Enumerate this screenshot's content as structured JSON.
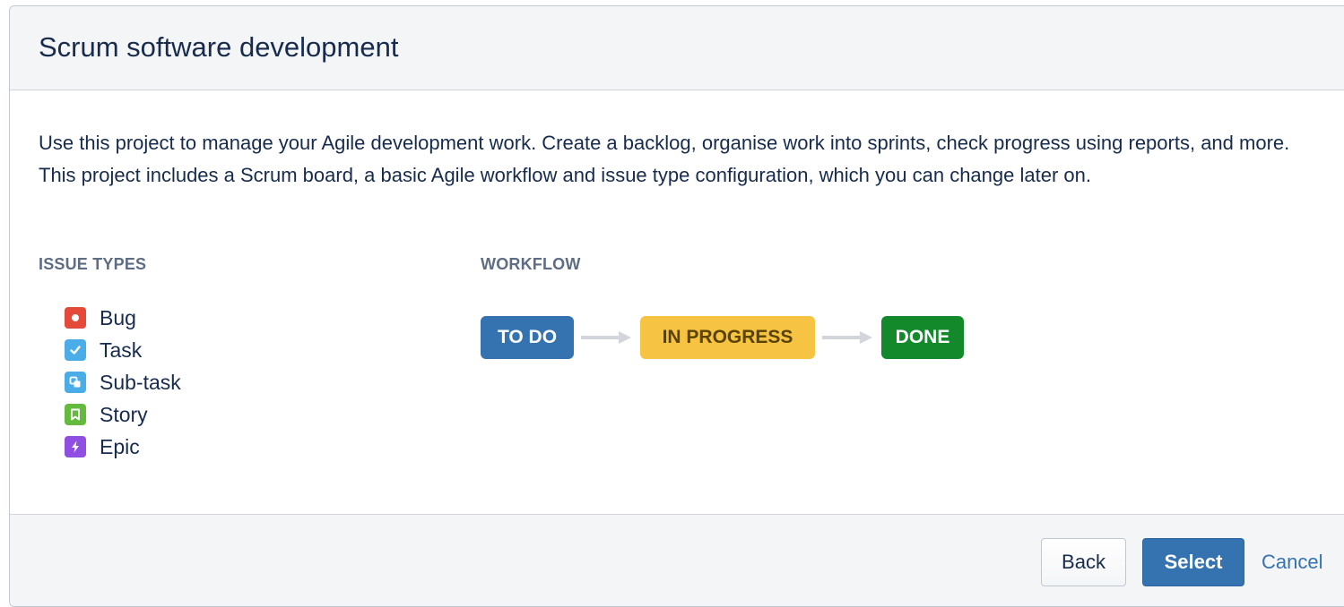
{
  "dialog": {
    "title": "Scrum software development",
    "description": "Use this project to manage your Agile development work. Create a backlog, organise work into sprints, check progress using reports, and more. This project includes a Scrum board, a basic Agile workflow and issue type configuration, which you can change later on."
  },
  "issue_types": {
    "heading": "ISSUE TYPES",
    "items": [
      {
        "label": "Bug",
        "icon": "bug-icon",
        "color": "#e5493a"
      },
      {
        "label": "Task",
        "icon": "task-icon",
        "color": "#4bade8"
      },
      {
        "label": "Sub-task",
        "icon": "subtask-icon",
        "color": "#4bade8"
      },
      {
        "label": "Story",
        "icon": "story-icon",
        "color": "#63ba3c"
      },
      {
        "label": "Epic",
        "icon": "epic-icon",
        "color": "#904ee2"
      }
    ]
  },
  "workflow": {
    "heading": "WORKFLOW",
    "statuses": [
      {
        "label": "TO DO",
        "bg": "#3572b0",
        "fg": "#ffffff"
      },
      {
        "label": "IN PROGRESS",
        "bg": "#f6c342",
        "fg": "#594300"
      },
      {
        "label": "DONE",
        "bg": "#14892c",
        "fg": "#ffffff"
      }
    ],
    "arrow_color": "#d2d6dc"
  },
  "footer": {
    "back_label": "Back",
    "select_label": "Select",
    "cancel_label": "Cancel"
  }
}
